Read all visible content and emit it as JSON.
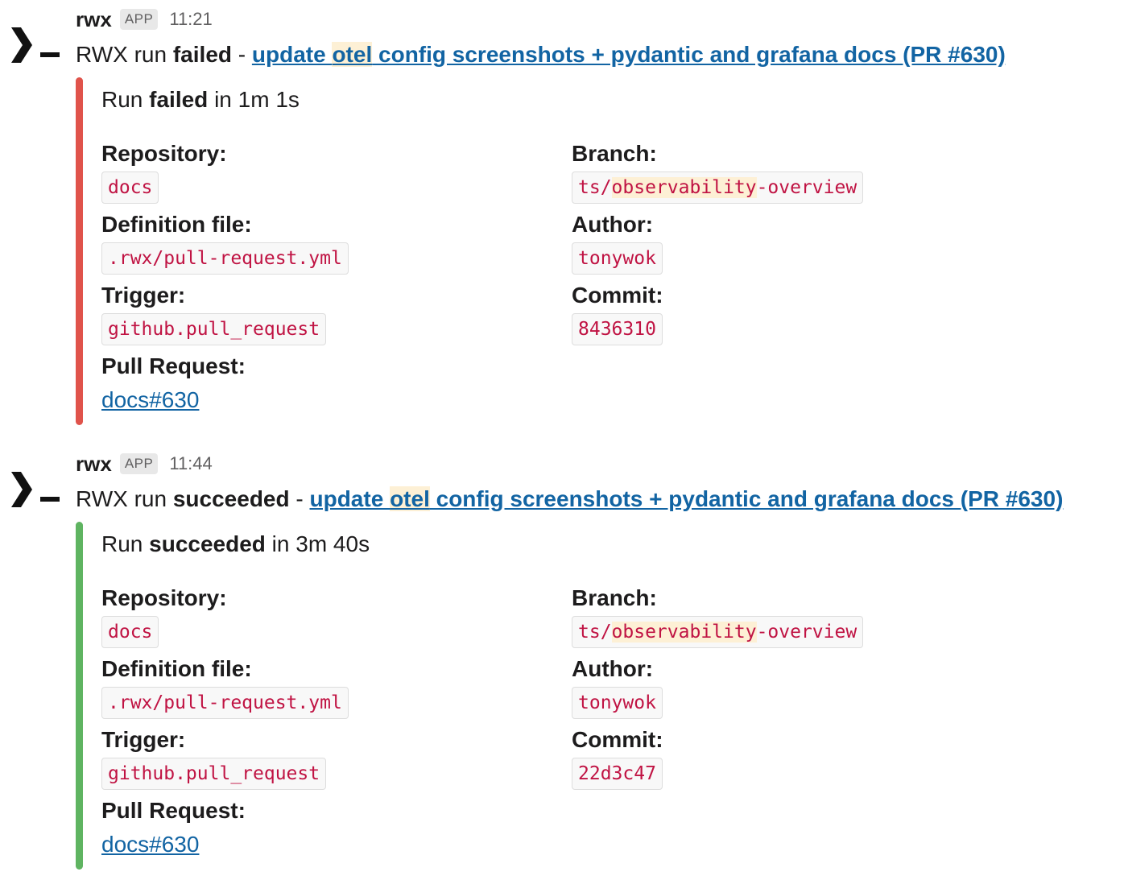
{
  "messages": [
    {
      "sender": "rwx",
      "badge": "APP",
      "time": "11:21",
      "title": {
        "prefix": "RWX run ",
        "status": "failed",
        "sep": " - ",
        "link_a": "update ",
        "link_hl": "otel",
        "link_b": " config screenshots + pydantic and grafana docs (PR #630)"
      },
      "status_color": "#e0534b",
      "summary": {
        "prefix": "Run ",
        "status": "failed",
        "suffix": " in 1m 1s"
      },
      "fields": {
        "repository_label": "Repository:",
        "repository": "docs",
        "branch_label": "Branch:",
        "branch_a": "ts/",
        "branch_hl": "observability",
        "branch_b": "-overview",
        "definition_label": "Definition file:",
        "definition": ".rwx/pull-request.yml",
        "author_label": "Author:",
        "author": "tonywok",
        "trigger_label": "Trigger:",
        "trigger": "github.pull_request",
        "commit_label": "Commit:",
        "commit": "8436310",
        "pr_label": "Pull Request:",
        "pr": "docs#630"
      }
    },
    {
      "sender": "rwx",
      "badge": "APP",
      "time": "11:44",
      "title": {
        "prefix": "RWX run ",
        "status": "succeeded",
        "sep": " - ",
        "link_a": "update ",
        "link_hl": "otel",
        "link_b": " config screenshots + pydantic and grafana docs (PR #630)"
      },
      "status_color": "#5fb461",
      "summary": {
        "prefix": "Run ",
        "status": "succeeded",
        "suffix": " in 3m 40s"
      },
      "fields": {
        "repository_label": "Repository:",
        "repository": "docs",
        "branch_label": "Branch:",
        "branch_a": "ts/",
        "branch_hl": "observability",
        "branch_b": "-overview",
        "definition_label": "Definition file:",
        "definition": ".rwx/pull-request.yml",
        "author_label": "Author:",
        "author": "tonywok",
        "trigger_label": "Trigger:",
        "trigger": "github.pull_request",
        "commit_label": "Commit:",
        "commit": "22d3c47",
        "pr_label": "Pull Request:",
        "pr": "docs#630"
      }
    }
  ],
  "avatar_icon": "rwx-terminal-prompt-icon"
}
